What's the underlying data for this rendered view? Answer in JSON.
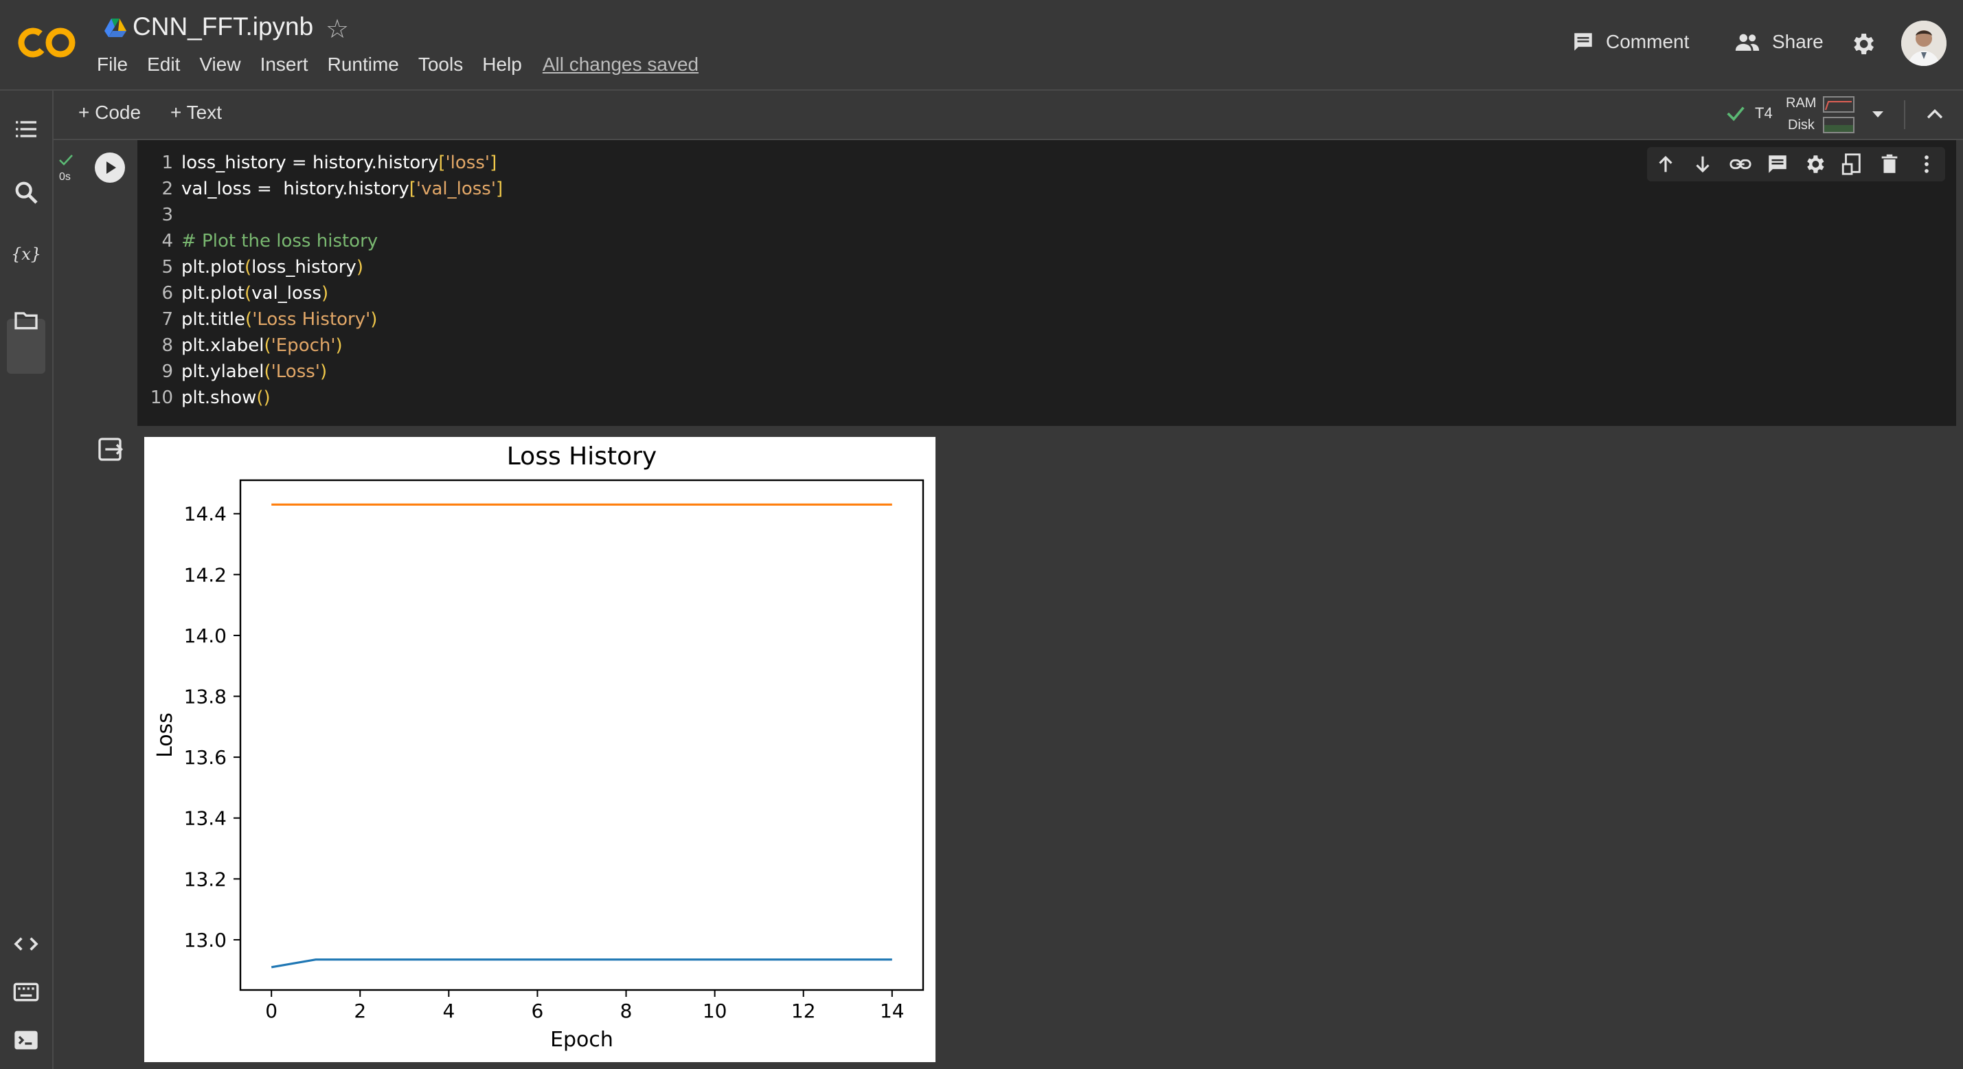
{
  "header": {
    "notebook_title": "CNN_FFT.ipynb",
    "menu": [
      "File",
      "Edit",
      "View",
      "Insert",
      "Runtime",
      "Tools",
      "Help"
    ],
    "save_status": "All changes saved",
    "comment_label": "Comment",
    "share_label": "Share"
  },
  "toolbar": {
    "add_code_label": "+ Code",
    "add_text_label": "+ Text",
    "runtime": "T4",
    "ram_label": "RAM",
    "disk_label": "Disk"
  },
  "cell": {
    "exec_time": "0s",
    "lines": [
      {
        "n": "1",
        "parts": [
          [
            "def",
            "loss_history = history.history"
          ],
          [
            "par",
            "["
          ],
          [
            "str",
            "'loss'"
          ],
          [
            "par",
            "]"
          ]
        ]
      },
      {
        "n": "2",
        "parts": [
          [
            "def",
            "val_loss =  history.history"
          ],
          [
            "par",
            "["
          ],
          [
            "str",
            "'val_loss'"
          ],
          [
            "par",
            "]"
          ]
        ]
      },
      {
        "n": "3",
        "parts": []
      },
      {
        "n": "4",
        "parts": [
          [
            "com",
            "# Plot the loss history"
          ]
        ]
      },
      {
        "n": "5",
        "parts": [
          [
            "def",
            "plt.plot"
          ],
          [
            "par",
            "("
          ],
          [
            "def",
            "loss_history"
          ],
          [
            "par",
            ")"
          ]
        ]
      },
      {
        "n": "6",
        "parts": [
          [
            "def",
            "plt.plot"
          ],
          [
            "par",
            "("
          ],
          [
            "def",
            "val_loss"
          ],
          [
            "par",
            ")"
          ]
        ]
      },
      {
        "n": "7",
        "parts": [
          [
            "def",
            "plt.title"
          ],
          [
            "par",
            "("
          ],
          [
            "str",
            "'Loss History'"
          ],
          [
            "par",
            ")"
          ]
        ]
      },
      {
        "n": "8",
        "parts": [
          [
            "def",
            "plt.xlabel"
          ],
          [
            "par",
            "("
          ],
          [
            "str",
            "'Epoch'"
          ],
          [
            "par",
            ")"
          ]
        ]
      },
      {
        "n": "9",
        "parts": [
          [
            "def",
            "plt.ylabel"
          ],
          [
            "par",
            "("
          ],
          [
            "str",
            "'Loss'"
          ],
          [
            "par",
            ")"
          ]
        ]
      },
      {
        "n": "10",
        "parts": [
          [
            "def",
            "plt.show"
          ],
          [
            "par",
            "()"
          ]
        ]
      }
    ]
  },
  "chart_data": {
    "type": "line",
    "title": "Loss History",
    "xlabel": "Epoch",
    "ylabel": "Loss",
    "xlim": [
      -0.7,
      14.7
    ],
    "ylim": [
      12.835,
      14.51
    ],
    "xticks": [
      0,
      2,
      4,
      6,
      8,
      10,
      12,
      14
    ],
    "yticks": [
      13.0,
      13.2,
      13.4,
      13.6,
      13.8,
      14.0,
      14.2,
      14.4
    ],
    "x": [
      0,
      1,
      2,
      3,
      4,
      5,
      6,
      7,
      8,
      9,
      10,
      11,
      12,
      13,
      14
    ],
    "series": [
      {
        "color": "#1f77b4",
        "values": [
          12.91,
          12.935,
          12.935,
          12.935,
          12.935,
          12.935,
          12.935,
          12.935,
          12.935,
          12.935,
          12.935,
          12.935,
          12.935,
          12.935,
          12.935
        ]
      },
      {
        "color": "#ff7f0e",
        "values": [
          14.43,
          14.43,
          14.43,
          14.43,
          14.43,
          14.43,
          14.43,
          14.43,
          14.43,
          14.43,
          14.43,
          14.43,
          14.43,
          14.43,
          14.43
        ]
      }
    ],
    "grid": false
  }
}
